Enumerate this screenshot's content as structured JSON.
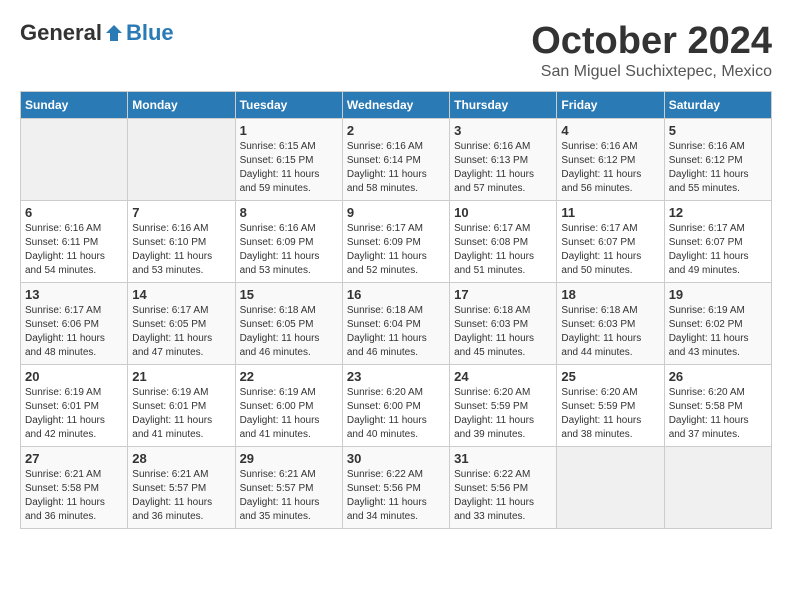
{
  "header": {
    "logo_general": "General",
    "logo_blue": "Blue",
    "month_title": "October 2024",
    "location": "San Miguel Suchixtepec, Mexico"
  },
  "days_of_week": [
    "Sunday",
    "Monday",
    "Tuesday",
    "Wednesday",
    "Thursday",
    "Friday",
    "Saturday"
  ],
  "weeks": [
    [
      {
        "day": "",
        "info": ""
      },
      {
        "day": "",
        "info": ""
      },
      {
        "day": "1",
        "sunrise": "6:15 AM",
        "sunset": "6:15 PM",
        "daylight": "11 hours and 59 minutes."
      },
      {
        "day": "2",
        "sunrise": "6:16 AM",
        "sunset": "6:14 PM",
        "daylight": "11 hours and 58 minutes."
      },
      {
        "day": "3",
        "sunrise": "6:16 AM",
        "sunset": "6:13 PM",
        "daylight": "11 hours and 57 minutes."
      },
      {
        "day": "4",
        "sunrise": "6:16 AM",
        "sunset": "6:12 PM",
        "daylight": "11 hours and 56 minutes."
      },
      {
        "day": "5",
        "sunrise": "6:16 AM",
        "sunset": "6:12 PM",
        "daylight": "11 hours and 55 minutes."
      }
    ],
    [
      {
        "day": "6",
        "sunrise": "6:16 AM",
        "sunset": "6:11 PM",
        "daylight": "11 hours and 54 minutes."
      },
      {
        "day": "7",
        "sunrise": "6:16 AM",
        "sunset": "6:10 PM",
        "daylight": "11 hours and 53 minutes."
      },
      {
        "day": "8",
        "sunrise": "6:16 AM",
        "sunset": "6:09 PM",
        "daylight": "11 hours and 53 minutes."
      },
      {
        "day": "9",
        "sunrise": "6:17 AM",
        "sunset": "6:09 PM",
        "daylight": "11 hours and 52 minutes."
      },
      {
        "day": "10",
        "sunrise": "6:17 AM",
        "sunset": "6:08 PM",
        "daylight": "11 hours and 51 minutes."
      },
      {
        "day": "11",
        "sunrise": "6:17 AM",
        "sunset": "6:07 PM",
        "daylight": "11 hours and 50 minutes."
      },
      {
        "day": "12",
        "sunrise": "6:17 AM",
        "sunset": "6:07 PM",
        "daylight": "11 hours and 49 minutes."
      }
    ],
    [
      {
        "day": "13",
        "sunrise": "6:17 AM",
        "sunset": "6:06 PM",
        "daylight": "11 hours and 48 minutes."
      },
      {
        "day": "14",
        "sunrise": "6:17 AM",
        "sunset": "6:05 PM",
        "daylight": "11 hours and 47 minutes."
      },
      {
        "day": "15",
        "sunrise": "6:18 AM",
        "sunset": "6:05 PM",
        "daylight": "11 hours and 46 minutes."
      },
      {
        "day": "16",
        "sunrise": "6:18 AM",
        "sunset": "6:04 PM",
        "daylight": "11 hours and 46 minutes."
      },
      {
        "day": "17",
        "sunrise": "6:18 AM",
        "sunset": "6:03 PM",
        "daylight": "11 hours and 45 minutes."
      },
      {
        "day": "18",
        "sunrise": "6:18 AM",
        "sunset": "6:03 PM",
        "daylight": "11 hours and 44 minutes."
      },
      {
        "day": "19",
        "sunrise": "6:19 AM",
        "sunset": "6:02 PM",
        "daylight": "11 hours and 43 minutes."
      }
    ],
    [
      {
        "day": "20",
        "sunrise": "6:19 AM",
        "sunset": "6:01 PM",
        "daylight": "11 hours and 42 minutes."
      },
      {
        "day": "21",
        "sunrise": "6:19 AM",
        "sunset": "6:01 PM",
        "daylight": "11 hours and 41 minutes."
      },
      {
        "day": "22",
        "sunrise": "6:19 AM",
        "sunset": "6:00 PM",
        "daylight": "11 hours and 41 minutes."
      },
      {
        "day": "23",
        "sunrise": "6:20 AM",
        "sunset": "6:00 PM",
        "daylight": "11 hours and 40 minutes."
      },
      {
        "day": "24",
        "sunrise": "6:20 AM",
        "sunset": "5:59 PM",
        "daylight": "11 hours and 39 minutes."
      },
      {
        "day": "25",
        "sunrise": "6:20 AM",
        "sunset": "5:59 PM",
        "daylight": "11 hours and 38 minutes."
      },
      {
        "day": "26",
        "sunrise": "6:20 AM",
        "sunset": "5:58 PM",
        "daylight": "11 hours and 37 minutes."
      }
    ],
    [
      {
        "day": "27",
        "sunrise": "6:21 AM",
        "sunset": "5:58 PM",
        "daylight": "11 hours and 36 minutes."
      },
      {
        "day": "28",
        "sunrise": "6:21 AM",
        "sunset": "5:57 PM",
        "daylight": "11 hours and 36 minutes."
      },
      {
        "day": "29",
        "sunrise": "6:21 AM",
        "sunset": "5:57 PM",
        "daylight": "11 hours and 35 minutes."
      },
      {
        "day": "30",
        "sunrise": "6:22 AM",
        "sunset": "5:56 PM",
        "daylight": "11 hours and 34 minutes."
      },
      {
        "day": "31",
        "sunrise": "6:22 AM",
        "sunset": "5:56 PM",
        "daylight": "11 hours and 33 minutes."
      },
      {
        "day": "",
        "info": ""
      },
      {
        "day": "",
        "info": ""
      }
    ]
  ]
}
